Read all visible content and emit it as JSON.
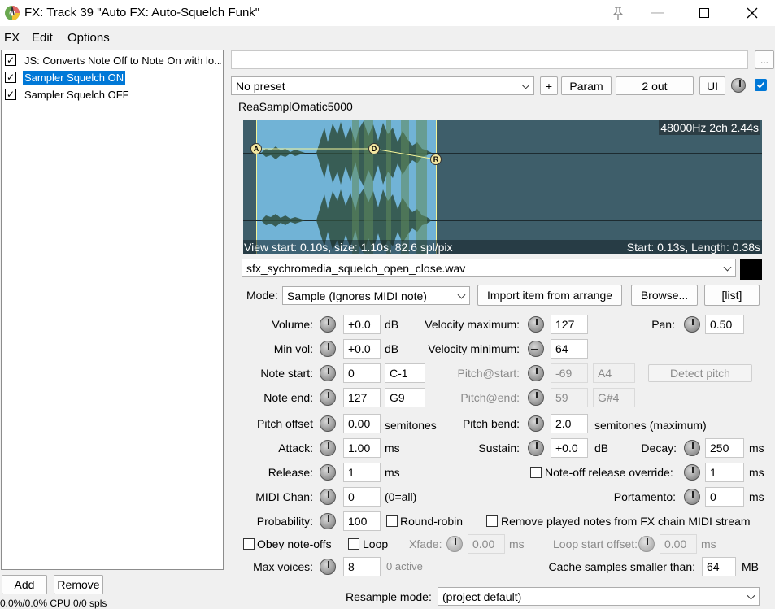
{
  "window": {
    "title": "FX: Track 39 \"Auto FX: Auto-Squelch Funk\""
  },
  "menu": [
    "FX",
    "Edit",
    "Options"
  ],
  "fx_chain": [
    {
      "label": "JS: Converts Note Off to Note On with lo...",
      "checked": true,
      "selected": false
    },
    {
      "label": "Sampler Squelch ON",
      "checked": true,
      "selected": true
    },
    {
      "label": "Sampler Squelch OFF",
      "checked": true,
      "selected": false
    }
  ],
  "fx_buttons": {
    "add": "Add",
    "remove": "Remove"
  },
  "status_text": "0.0%/0.0% CPU 0/0 spls",
  "toolbar": {
    "ellipsis": "...",
    "preset": "No preset",
    "plus": "+",
    "param": "Param",
    "out": "2 out",
    "ui": "UI"
  },
  "plugin_name": "ReaSamplOmatic5000",
  "waveform": {
    "info": "48000Hz 2ch 2.44s",
    "view_info": "View start: 0.10s, size: 1.10s, 82.6 spl/pix",
    "sel_info": "Start: 0.13s, Length: 0.38s",
    "markers": [
      "A",
      "D",
      "R"
    ]
  },
  "file": "sfx_sychromedia_squelch_open_close.wav",
  "mode": {
    "label": "Mode:",
    "value": "Sample (Ignores MIDI note)",
    "import": "Import item from arrange",
    "browse": "Browse...",
    "list": "[list]"
  },
  "params": {
    "volume": {
      "label": "Volume:",
      "value": "+0.0",
      "unit": "dB"
    },
    "min_vol": {
      "label": "Min vol:",
      "value": "+0.0",
      "unit": "dB"
    },
    "note_start": {
      "label": "Note start:",
      "value": "0",
      "note": "C-1"
    },
    "note_end": {
      "label": "Note end:",
      "value": "127",
      "note": "G9"
    },
    "pitch_offset": {
      "label": "Pitch offset",
      "value": "0.00",
      "unit": "semitones"
    },
    "attack": {
      "label": "Attack:",
      "value": "1.00",
      "unit": "ms"
    },
    "release": {
      "label": "Release:",
      "value": "1",
      "unit": "ms"
    },
    "midi_chan": {
      "label": "MIDI Chan:",
      "value": "0",
      "unit": "(0=all)"
    },
    "probability": {
      "label": "Probability:",
      "value": "100"
    },
    "max_voices": {
      "label": "Max voices:",
      "value": "8",
      "unit": "0 active"
    },
    "vel_max": {
      "label": "Velocity maximum:",
      "value": "127"
    },
    "vel_min": {
      "label": "Velocity minimum:",
      "value": "64"
    },
    "pitch_start": {
      "label": "Pitch@start:",
      "value": "-69",
      "note": "A4"
    },
    "pitch_end": {
      "label": "Pitch@end:",
      "value": "59",
      "note": "G#4"
    },
    "detect_pitch": "Detect pitch",
    "pitch_bend": {
      "label": "Pitch bend:",
      "value": "2.0",
      "unit": "semitones (maximum)"
    },
    "sustain": {
      "label": "Sustain:",
      "value": "+0.0",
      "unit": "dB"
    },
    "pan": {
      "label": "Pan:",
      "value": "0.50"
    },
    "decay": {
      "label": "Decay:",
      "value": "250",
      "unit": "ms"
    },
    "noteoff_override": {
      "label": "Note-off release override:",
      "value": "1",
      "unit": "ms"
    },
    "portamento": {
      "label": "Portamento:",
      "value": "0",
      "unit": "ms"
    },
    "round_robin": "Round-robin",
    "remove_played": "Remove played notes from FX chain MIDI stream",
    "obey_noteoffs": "Obey note-offs",
    "loop": "Loop",
    "xfade": {
      "label": "Xfade:",
      "value": "0.00",
      "unit": "ms"
    },
    "loop_start": {
      "label": "Loop start offset:",
      "value": "0.00",
      "unit": "ms"
    },
    "cache": {
      "label": "Cache samples smaller than:",
      "value": "64",
      "unit": "MB"
    },
    "resample": {
      "label": "Resample mode:",
      "value": "(project default)"
    }
  }
}
